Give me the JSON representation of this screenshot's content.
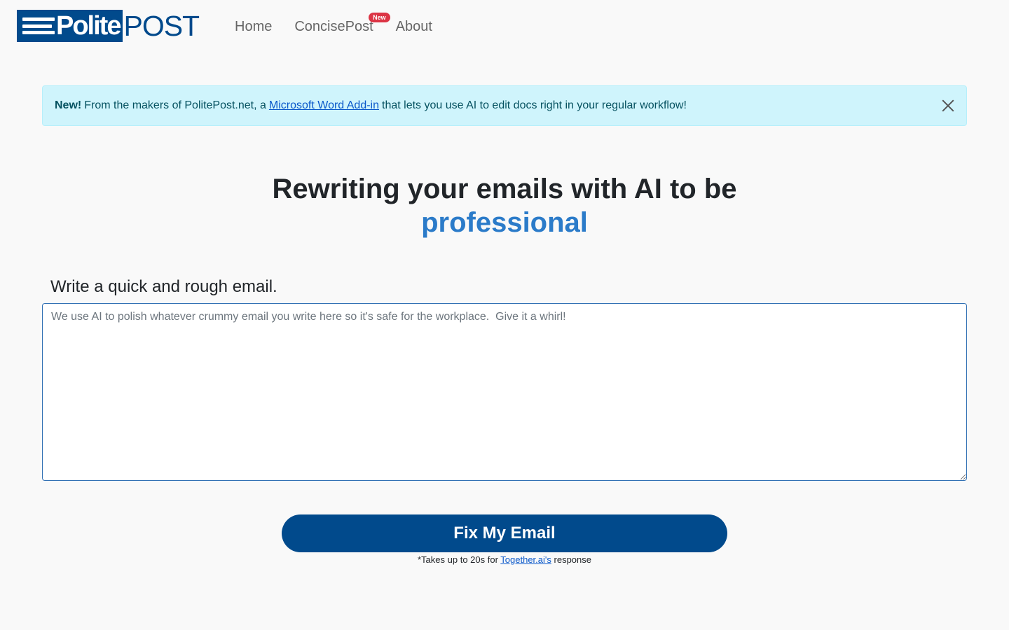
{
  "brand": {
    "logo_left_text": "Polite",
    "logo_right_text": "POST",
    "primary_color": "#014a8c",
    "accent_color": "#2b7bc9"
  },
  "nav": {
    "items": [
      {
        "label": "Home"
      },
      {
        "label": "ConcisePost",
        "badge": "New"
      },
      {
        "label": "About"
      }
    ]
  },
  "alert": {
    "strong": "New!",
    "text_before": "From the makers of PolitePost.net, a",
    "link_text": "Microsoft Word Add-in",
    "text_after": "that lets you use AI to edit docs right in your regular workflow!",
    "close_icon": "close-icon"
  },
  "hero": {
    "line1": "Rewriting your emails with AI to be",
    "line2": "professional"
  },
  "form": {
    "label": "Write a quick and rough email.",
    "placeholder": "We use AI to polish whatever crummy email you write here so it's safe for the workplace.  Give it a whirl!",
    "value": ""
  },
  "button": {
    "label": "Fix My Email"
  },
  "footnote": {
    "text_before": "*Takes up to 20s for",
    "link_text": "Together.ai's",
    "text_after": "response"
  }
}
